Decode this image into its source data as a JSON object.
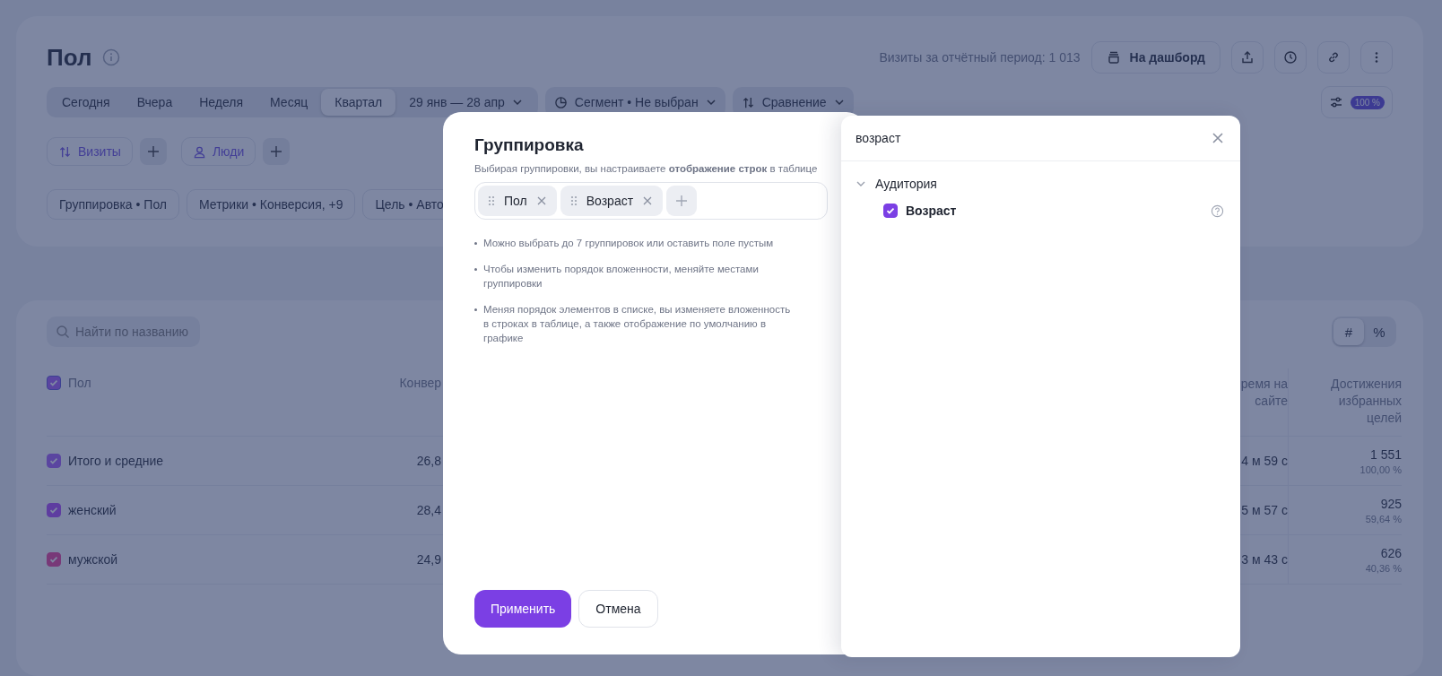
{
  "header": {
    "title": "Пол",
    "visits_summary": "Визиты за отчётный период: 1 013",
    "dashboard_button": "На дашборд",
    "periods": [
      {
        "label": "Сегодня",
        "selected": false
      },
      {
        "label": "Вчера",
        "selected": false
      },
      {
        "label": "Неделя",
        "selected": false
      },
      {
        "label": "Месяц",
        "selected": false
      },
      {
        "label": "Квартал",
        "selected": true
      }
    ],
    "date_range": "29 янв — 28 апр",
    "segment": "Сегмент • Не выбран",
    "comparison": "Сравнение",
    "zoom_badge": "100 %",
    "metric_chips": [
      {
        "kind": "visits",
        "label": "Визиты"
      },
      {
        "kind": "people",
        "label": "Люди"
      }
    ],
    "filters": [
      "Группировка • Пол",
      "Метрики • Конверсия, +9",
      "Цель • Авто"
    ]
  },
  "table": {
    "search": {
      "placeholder": "Найти по названию"
    },
    "view_toggle": [
      {
        "label": "#",
        "selected": true
      },
      {
        "label": "%",
        "selected": false
      }
    ],
    "header_checked": true,
    "columns": [
      "Пол",
      "Конвер",
      "ремя на сайте",
      "Достижения избранных целей"
    ],
    "rows": [
      {
        "name": "Итого и средние",
        "checked": true,
        "color": "#5a45a0",
        "conversion": "26,8",
        "time": "4 м 59 с",
        "goals": "1 551",
        "goals_share": "100,00 %"
      },
      {
        "name": "женский",
        "checked": true,
        "color": "#5e3da0",
        "conversion": "28,4",
        "time": "5 м 57 с",
        "goals": "925",
        "goals_share": "59,64 %"
      },
      {
        "name": "мужской",
        "checked": true,
        "color": "#783978",
        "conversion": "24,9",
        "time": "3 м 43 с",
        "goals": "626",
        "goals_share": "40,36 %"
      }
    ]
  },
  "grouping_dialog": {
    "title": "Группировка",
    "subtitle": "Выбирая группировки, вы настраиваете **отображение строк** в таблице",
    "groups": [
      "Пол",
      "Возраст"
    ],
    "hints": [
      "Можно выбрать до 7 группировок или оставить поле пустым",
      "Чтобы изменить порядок вложенности, меняйте местами группировки",
      "Меняя порядок элементов в списке, вы изменяете вложенность в строках в таблице, а также отображение по умолчанию в графике"
    ],
    "apply": "Применить",
    "cancel": "Отмена"
  },
  "picker": {
    "search_value": "возраст",
    "categories": [
      {
        "label": "Аудитория",
        "expanded": true,
        "children": [
          {
            "label": "Возраст",
            "checked": true
          }
        ]
      }
    ]
  }
}
